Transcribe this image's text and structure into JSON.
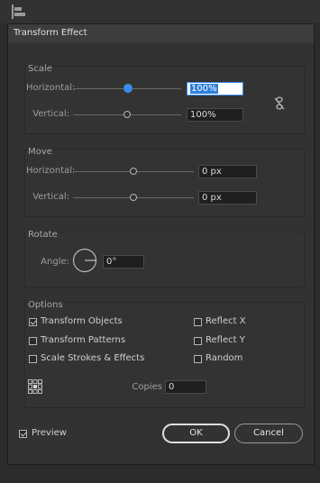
{
  "dialog": {
    "title": "Transform Effect"
  },
  "scale": {
    "title": "Scale",
    "horizontal_label": "Horizontal:",
    "horizontal_value": "100%",
    "vertical_label": "Vertical:",
    "vertical_value": "100%"
  },
  "move": {
    "title": "Move",
    "horizontal_label": "Horizontal:",
    "horizontal_value": "0 px",
    "vertical_label": "Vertical:",
    "vertical_value": "0 px"
  },
  "rotate": {
    "title": "Rotate",
    "angle_label": "Angle:",
    "angle_value": "0°"
  },
  "options": {
    "title": "Options",
    "transform_objects": "Transform Objects",
    "transform_patterns": "Transform Patterns",
    "scale_strokes": "Scale Strokes & Effects",
    "reflect_x": "Reflect X",
    "reflect_y": "Reflect Y",
    "random": "Random",
    "copies_label": "Copies",
    "copies_value": "0"
  },
  "footer": {
    "preview_label": "Preview",
    "ok_label": "OK",
    "cancel_label": "Cancel"
  },
  "colors": {
    "accent": "#3c8cf0",
    "background": "#323232"
  },
  "icons": [
    "align-panel-icon",
    "constrain-proportions-icon",
    "reference-point-icon",
    "angle-dial-icon",
    "checkmark-icon"
  ]
}
